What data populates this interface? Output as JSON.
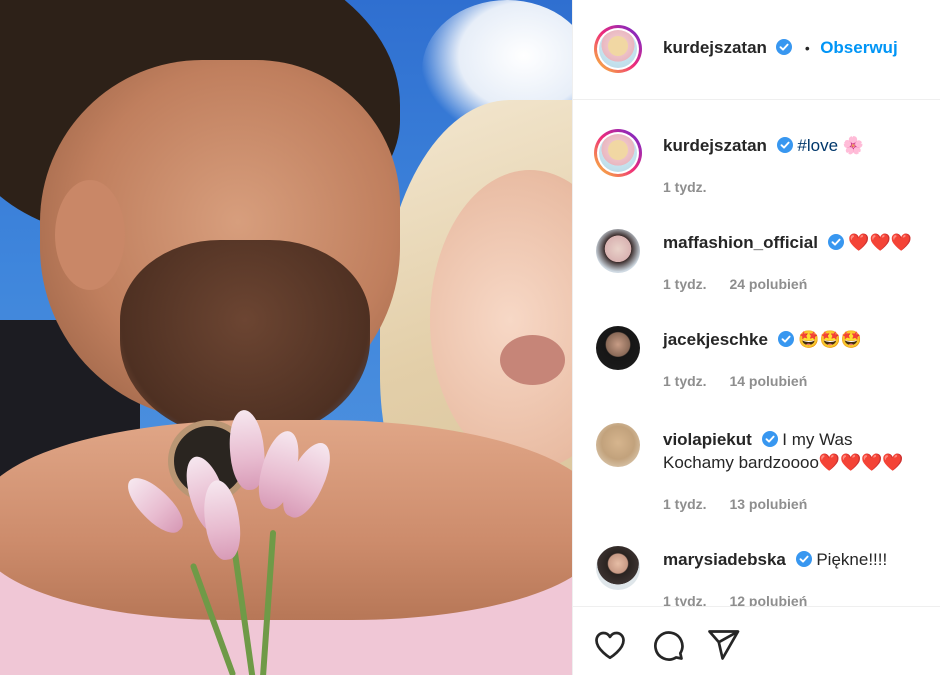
{
  "post": {
    "author": "kurdejszatan",
    "follow_label": "Obserwuj",
    "dot": "•"
  },
  "caption": {
    "user": "kurdejszatan",
    "hashtag": "#love",
    "emoji": "🌸",
    "time": "1 tydz."
  },
  "comments": [
    {
      "user": "maffashion_official",
      "text": "❤️❤️❤️",
      "time": "1 tydz.",
      "likes": "24 polubień"
    },
    {
      "user": "jacekjeschke",
      "text": "🤩🤩🤩",
      "time": "1 tydz.",
      "likes": "14 polubień"
    },
    {
      "user": "violapiekut",
      "text_line1": "I my Was",
      "text_line2": "Kochamy bardzoooo❤️❤️❤️❤️",
      "time": "1 tydz.",
      "likes": "13 polubień"
    },
    {
      "user": "marysiadebska",
      "text": "Piękne!!!!",
      "time": "1 tydz.",
      "likes": "12 polubień"
    }
  ],
  "actions": {
    "like_icon": "heart-icon",
    "comment_icon": "comment-icon",
    "share_icon": "share-icon"
  },
  "colors": {
    "link_blue": "#0095f6",
    "verified_blue": "#3897f0",
    "meta_gray": "#8e8e8e",
    "hashtag": "#00376b"
  }
}
